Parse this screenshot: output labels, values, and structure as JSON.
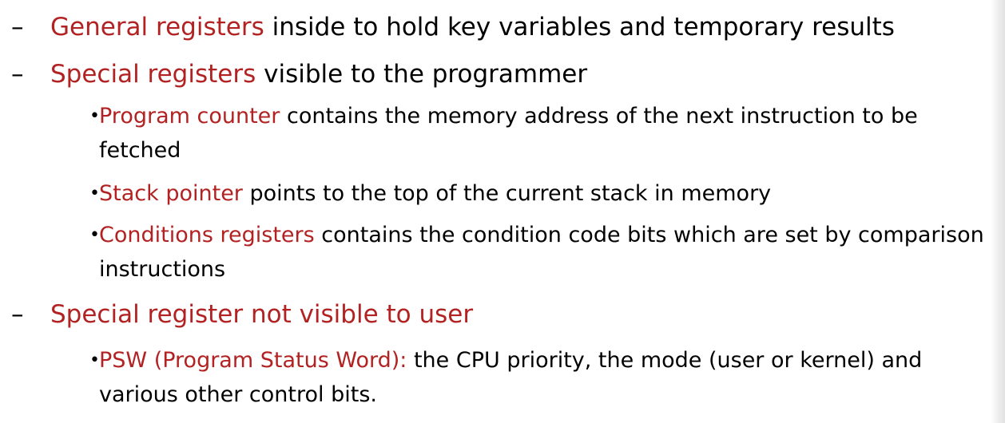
{
  "colors": {
    "term": "#b22222",
    "text": "#000000",
    "background": "#ffffff"
  },
  "items": [
    {
      "level": 1,
      "marker": "–",
      "term": "General  registers",
      "text": " inside to hold key variables and temporary results"
    },
    {
      "level": 1,
      "marker": "–",
      "term": "Special registers",
      "text": " visible to the programmer"
    },
    {
      "level": 2,
      "marker": "•",
      "term": "Program counter",
      "text": "  contains the memory address of the next instruction to be fetched"
    },
    {
      "level": 2,
      "marker": "•",
      "term": "Stack pointer",
      "text": " points to the top of the current stack in memory"
    },
    {
      "level": 2,
      "marker": "•",
      "term": "Conditions registers",
      "text": " contains the condition code bits which are set by comparison instructions"
    },
    {
      "level": 1,
      "marker": "–",
      "term": "Special register not visible to user",
      "text": ""
    },
    {
      "level": 2,
      "marker": "•",
      "term": "PSW (Program Status Word):",
      "text": " the CPU priority, the mode (user or kernel) and various other control bits."
    }
  ]
}
